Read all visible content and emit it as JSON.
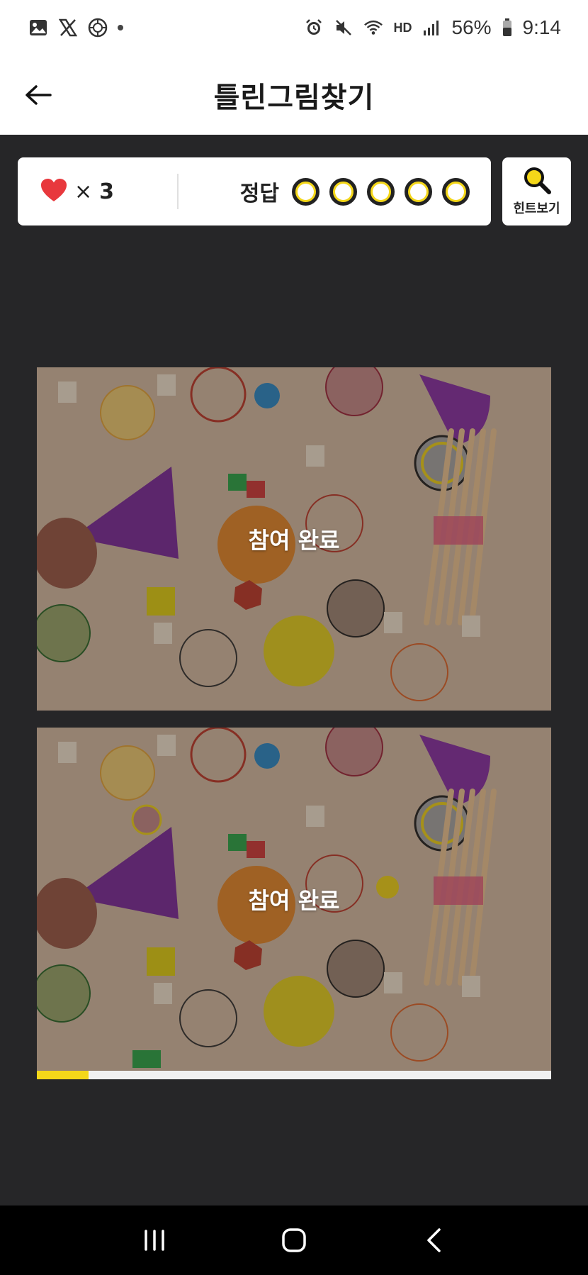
{
  "status_bar": {
    "left_icons": [
      "gallery-icon",
      "x-logo-icon",
      "badge-icon",
      "dot-icon"
    ],
    "right_icons": [
      "alarm-icon",
      "mute-icon",
      "wifi-icon",
      "hd-voice-icon",
      "signal-icon"
    ],
    "battery": "56%",
    "time": "9:14",
    "hd_label": "HD"
  },
  "app_bar": {
    "title": "틀린그림찾기",
    "back_icon": "arrow-left-icon"
  },
  "score": {
    "heart_icon": "heart-icon",
    "times": "×",
    "lives": "3",
    "answers_label": "정답",
    "answers_total": 5,
    "answers_found": 0
  },
  "hint": {
    "label": "힌트보기",
    "icon": "magnifier-icon"
  },
  "images": {
    "top_overlay": "참여 완료",
    "bottom_overlay": "참여 완료"
  },
  "progress": {
    "fraction": 0.1
  },
  "colors": {
    "accent_yellow": "#f4d719",
    "heart_red": "#e8383d",
    "background": "#262628"
  },
  "nav": {
    "recent_icon": "recent-apps-icon",
    "home_icon": "home-icon",
    "back_icon": "back-chevron-icon"
  }
}
